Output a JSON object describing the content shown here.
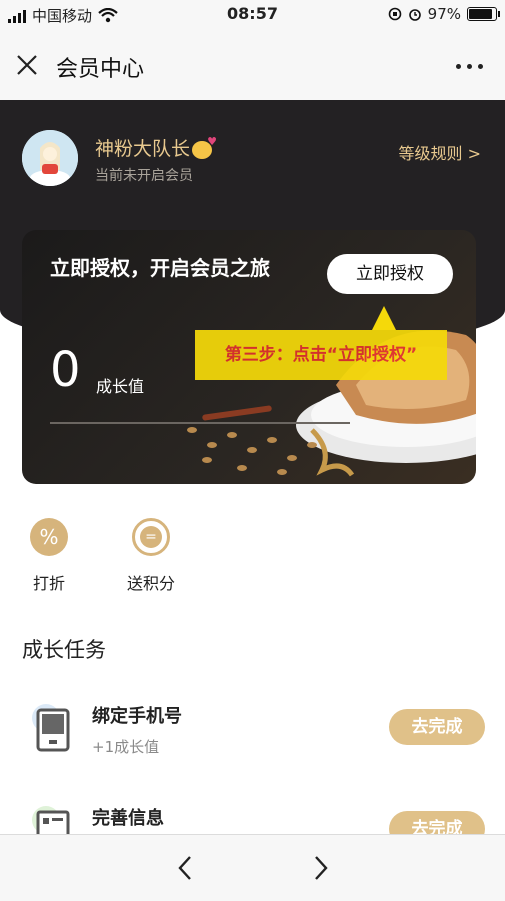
{
  "status_bar": {
    "carrier": "中国移动",
    "time": "08:57",
    "battery_percent": "97%",
    "battery_level": 0.97,
    "icons": [
      "signal-icon",
      "wifi-icon",
      "orientation-lock-icon",
      "alarm-icon",
      "battery-icon"
    ]
  },
  "nav": {
    "title": "会员中心",
    "icons": [
      "close-icon",
      "more-icon"
    ]
  },
  "profile": {
    "name": "神粉大队长",
    "status": "当前未开启会员",
    "level_rules": "等级规则 >"
  },
  "card": {
    "title": "立即授权，开启会员之旅",
    "auth_button": "立即授权",
    "growth_value": "0",
    "growth_label": "成长值",
    "growth_progress": 0
  },
  "tooltip": {
    "text": "第三步：点击“立即授权”"
  },
  "benefits": [
    {
      "label": "打折",
      "icon": "percent-icon",
      "glyph": "%"
    },
    {
      "label": "送积分",
      "icon": "points-icon",
      "glyph": "="
    }
  ],
  "tasks_section": {
    "title": "成长任务",
    "tasks": [
      {
        "title": "绑定手机号",
        "subtitle": "+1成长值",
        "button": "去完成",
        "icon": "phone-icon"
      },
      {
        "title": "完善信息",
        "subtitle": "",
        "button": "去完成",
        "icon": "profile-form-icon"
      }
    ]
  },
  "colors": {
    "header_bg": "#232123",
    "gold": "#e8c98f",
    "task_button": "#e0c189",
    "tooltip_bg": "#f5d90a",
    "tooltip_text": "#e0322e"
  },
  "bottom_bar": {
    "icons": [
      "back-arrow-icon",
      "forward-arrow-icon"
    ]
  }
}
